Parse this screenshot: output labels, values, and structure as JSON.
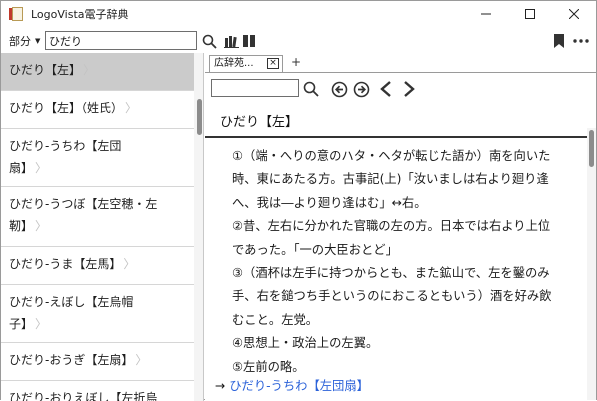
{
  "window": {
    "title": "LogoVista電子辞典",
    "controls": [
      "minimize",
      "maximize",
      "close"
    ]
  },
  "toolbar": {
    "mode_label": "部分",
    "search_value": "ひだり",
    "icons": [
      "search-icon",
      "books-icon",
      "columns-icon",
      "bookmark-icon",
      "more-icon"
    ]
  },
  "results": [
    {
      "label": "ひだり【左】",
      "chevron": "〉"
    },
    {
      "label": "ひだり【左】（姓氏）",
      "chevron": "〉"
    },
    {
      "label_lines": [
        "ひだり‐うちわ【左団",
        "扇】"
      ],
      "chevron": "〉"
    },
    {
      "label_lines": [
        "ひだり‐うつぼ【左空穂・左",
        "靭】"
      ],
      "chevron": "〉"
    },
    {
      "label": "ひだり‐うま【左馬】",
      "chevron": "〉"
    },
    {
      "label_lines": [
        "ひだり‐えぼし【左烏帽",
        "子】"
      ],
      "chevron": "〉"
    },
    {
      "label": "ひだり‐おうぎ【左扇】",
      "chevron": "〉"
    },
    {
      "label": "ひだり‐おりえぼし【左折烏",
      "chevron": ""
    }
  ],
  "tab": {
    "label": "広辞苑...",
    "close": "×",
    "add": "+"
  },
  "entry": {
    "headword": "ひだり【左】",
    "lines": [
      "①（端・へりの意のハタ・ヘタが転じた語か）南を向いた",
      "時、東にあたる方。古事記(上)「汝いましは右より廻り逢",
      "へ、我は―より廻り逢はむ」↔右。",
      "②昔、左右に分かれた官職の左の方。日本では右より上位",
      "であった。「一の大臣おとど」",
      "③（酒杯は左手に持つからとも、また鉱山で、左を鑿のみ",
      "手、右を鎚つち手というのにおこるともいう）酒を好み飲",
      "むこと。左党。",
      "④思想上・政治上の左翼。",
      "⑤左前の略。"
    ],
    "link_arrow": "→",
    "link_text": "ひだり‐うちわ【左団扇】"
  },
  "colors": {
    "accent_link": "#2b62d9",
    "selected_row": "#cbcbcb"
  }
}
